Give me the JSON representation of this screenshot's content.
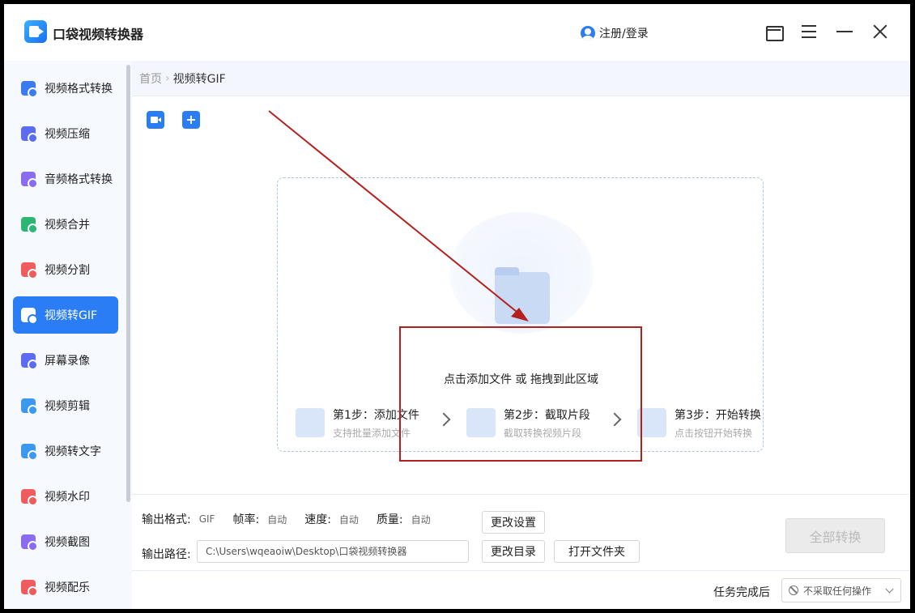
{
  "app": {
    "title": "口袋视频转换器",
    "login": "注册/登录"
  },
  "sidebar": {
    "items": [
      {
        "label": "视频格式转换",
        "color": "#3b7bf0"
      },
      {
        "label": "视频压缩",
        "color": "#5b6cf0"
      },
      {
        "label": "音频格式转换",
        "color": "#8a6cf0"
      },
      {
        "label": "视频合并",
        "color": "#2bb673"
      },
      {
        "label": "视频分割",
        "color": "#f05b5b"
      },
      {
        "label": "视频转GIF",
        "color": "#ffffff",
        "active": true
      },
      {
        "label": "屏幕录像",
        "color": "#5b6cf0"
      },
      {
        "label": "视频剪辑",
        "color": "#3b9af0"
      },
      {
        "label": "视频转文字",
        "color": "#3b9af0"
      },
      {
        "label": "视频水印",
        "color": "#f05b5b"
      },
      {
        "label": "视频截图",
        "color": "#8a6cf0"
      },
      {
        "label": "视频配乐",
        "color": "#f05b5b"
      }
    ]
  },
  "breadcrumb": {
    "home": "首页",
    "separator": "›",
    "current": "视频转GIF"
  },
  "dropzone": {
    "text": "点击添加文件 或 拖拽到此区域",
    "steps": [
      {
        "title": "第1步：添加文件",
        "desc": "支持批量添加文件"
      },
      {
        "title": "第2步：截取片段",
        "desc": "截取转换视频片段"
      },
      {
        "title": "第3步：开始转换",
        "desc": "点击按钮开始转换"
      }
    ]
  },
  "output": {
    "format_label": "输出格式:",
    "format_value": "GIF",
    "fps_label": "帧率:",
    "fps_value": "自动",
    "speed_label": "速度:",
    "speed_value": "自动",
    "quality_label": "质量:",
    "quality_value": "自动",
    "settings_button": "更改设置",
    "path_label": "输出路径:",
    "path_value": "C:\\Users\\wqeaoiw\\Desktop\\口袋视频转换器",
    "change_dir_button": "更改目录",
    "open_folder_button": "打开文件夹",
    "convert_all_button": "全部转换"
  },
  "footer": {
    "after_label": "任务完成后",
    "after_value": "不采取任何操作"
  },
  "colors": {
    "accent": "#2b7df5",
    "annotation": "#b3201e"
  }
}
